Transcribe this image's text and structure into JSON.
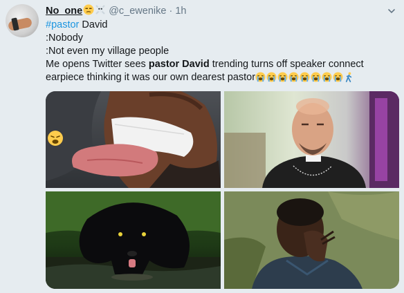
{
  "tweet": {
    "display_name": "No_one",
    "name_emojis": [
      "unamused-face-emoji",
      "skull-and-crossbones-emoji"
    ],
    "handle": "@c_ewenike",
    "separator": "·",
    "time": "1h",
    "menu_icon": "chevron-down-icon",
    "lines": [
      {
        "hashtag": "#pastor",
        "rest": " David"
      },
      {
        "text": ":Nobody"
      },
      {
        "text": ":Not even my village people"
      },
      {
        "pre": "Me opens Twitter sees ",
        "bold": "pastor David",
        "post": " trending turns off speaker connect"
      },
      {
        "pre": "earpiece thinking it was our own dearest pastor",
        "emojis": "loudly-crying-face x8, person-walking"
      }
    ],
    "media": [
      {
        "name": "photo-man-tongue",
        "overlay_emoji": "weary-face-emoji"
      },
      {
        "name": "photo-priest"
      },
      {
        "name": "photo-panther-drinking"
      },
      {
        "name": "photo-boy-hand-on-face"
      }
    ]
  },
  "colors": {
    "background": "#e6ecf0",
    "link": "#1b95e0",
    "secondary_text": "#657786",
    "primary_text": "#14171a"
  }
}
